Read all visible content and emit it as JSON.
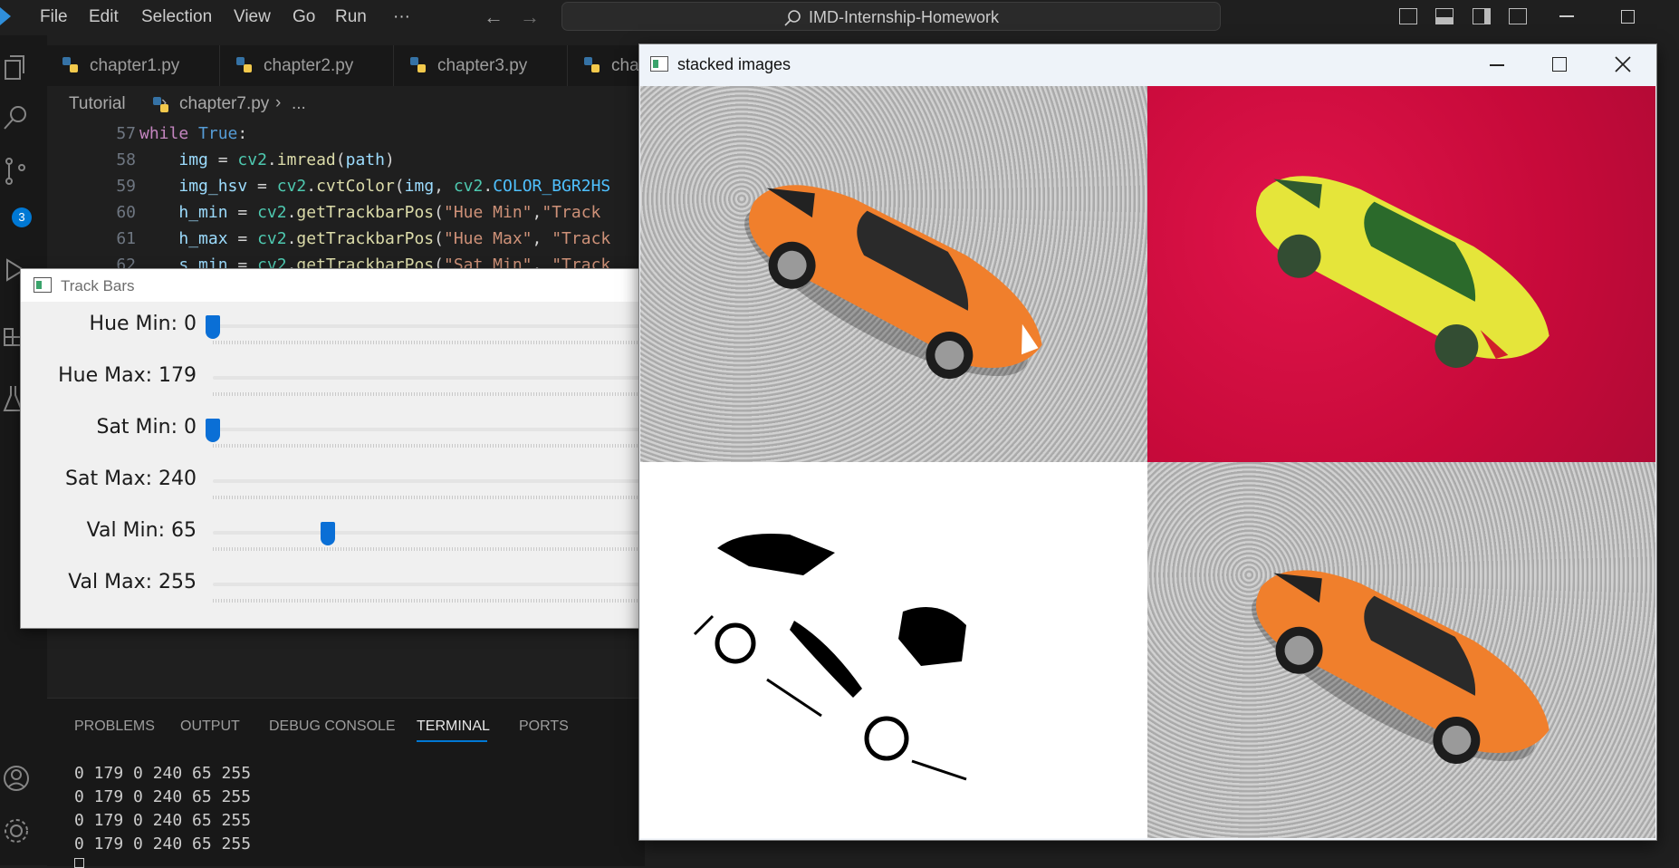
{
  "menu": [
    "File",
    "Edit",
    "Selection",
    "View",
    "Go",
    "Run",
    "···"
  ],
  "search": {
    "label": "IMD-Internship-Homework"
  },
  "activity": {
    "badge": "3"
  },
  "tabs": [
    "chapter1.py",
    "chapter2.py",
    "chapter3.py",
    "cha"
  ],
  "breadcrumb": {
    "folder": "Tutorial",
    "file": "chapter7.py",
    "more": "..."
  },
  "editor": {
    "line_numbers": [
      "57",
      "58",
      "59",
      "60",
      "61",
      "62"
    ]
  },
  "trackbars": {
    "title": "Track Bars",
    "rows": [
      {
        "label": "Hue Min: 0",
        "value": 0,
        "max": 179
      },
      {
        "label": "Hue Max: 179",
        "value": 179,
        "max": 179
      },
      {
        "label": "Sat Min: 0",
        "value": 0,
        "max": 255
      },
      {
        "label": "Sat Max: 240",
        "value": 240,
        "max": 255
      },
      {
        "label": "Val Min: 65",
        "value": 65,
        "max": 255
      },
      {
        "label": "Val Max: 255",
        "value": 255,
        "max": 255
      }
    ]
  },
  "stacked": {
    "title": "stacked images"
  },
  "panel": {
    "tabs": [
      "PROBLEMS",
      "OUTPUT",
      "DEBUG CONSOLE",
      "TERMINAL",
      "PORTS"
    ],
    "active": "TERMINAL",
    "lines": [
      "0 179 0 240 65 255",
      "0 179 0 240 65 255",
      "0 179 0 240 65 255",
      "0 179 0 240 65 255"
    ]
  }
}
